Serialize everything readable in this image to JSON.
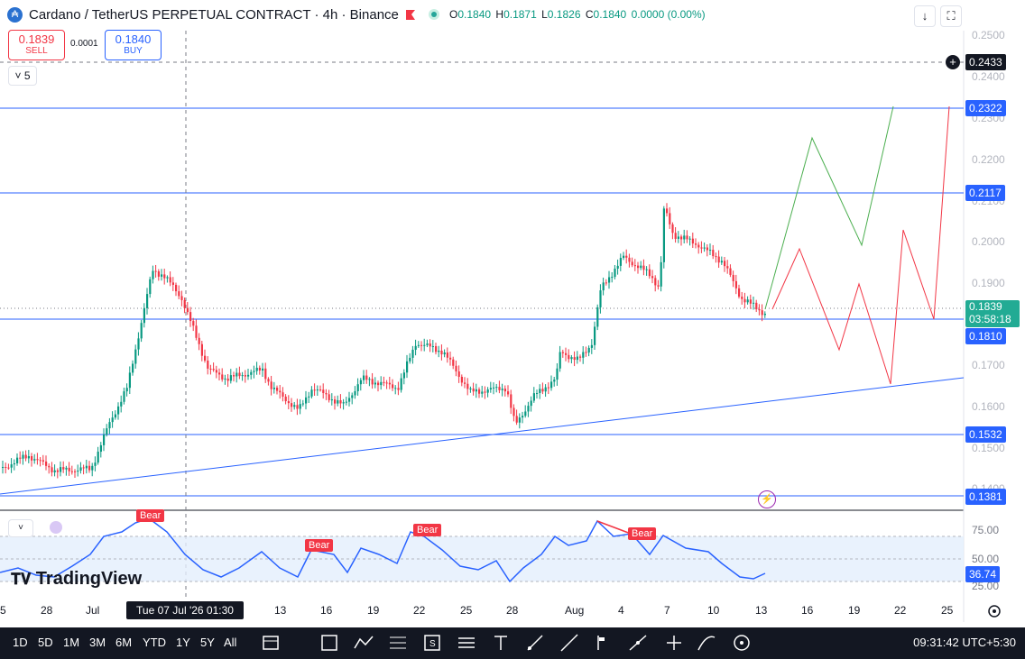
{
  "header": {
    "logo_glyph": "₳",
    "title": "Cardano / TetherUS PERPETUAL CONTRACT · 4h · Binance",
    "ohlc": {
      "o_label": "O",
      "o_value": "0.1840",
      "h_label": "H",
      "h_value": "0.1871",
      "l_label": "L",
      "l_value": "0.1826",
      "c_label": "C",
      "c_value": "0.1840",
      "change": "0.0000 (0.00%)"
    },
    "icons": [
      "flag-icon",
      "status-dot",
      "arrow-down-icon",
      "fullscreen-icon"
    ]
  },
  "trade": {
    "sell_price": "0.1839",
    "sell_label": "SELL",
    "spread": "0.0001",
    "buy_price": "0.1840",
    "buy_label": "BUY"
  },
  "collapse": {
    "label": "5"
  },
  "price_axis": {
    "ticks": [
      "0.2500",
      "0.2400",
      "0.2300",
      "0.2200",
      "0.2100",
      "0.2000",
      "0.1900",
      "0.1700",
      "0.1600",
      "0.1500",
      "0.1400"
    ],
    "labels": [
      {
        "text": "0.2433",
        "kind": "crosshair"
      },
      {
        "text": "0.2322",
        "kind": "level"
      },
      {
        "text": "0.2117",
        "kind": "level"
      },
      {
        "text": "0.1839",
        "kind": "price"
      },
      {
        "text": "03:58:18",
        "kind": "countdown"
      },
      {
        "text": "0.1810",
        "kind": "level"
      },
      {
        "text": "0.1532",
        "kind": "level"
      },
      {
        "text": "0.1381",
        "kind": "level"
      }
    ]
  },
  "rsi": {
    "axis": [
      "75.00",
      "50.00",
      "25.00"
    ],
    "value": "36.74",
    "bear_labels": [
      "Bear",
      "Bear",
      "Bear",
      "Bear"
    ]
  },
  "time_axis": {
    "labels": [
      "5",
      "28",
      "Jul",
      "13",
      "16",
      "19",
      "22",
      "25",
      "28",
      "Aug",
      "4",
      "7",
      "10",
      "13",
      "16",
      "19",
      "22",
      "25"
    ],
    "cursor": "Tue 07 Jul '26   01:30"
  },
  "branding": {
    "logo": "TradingView"
  },
  "bottom_bar": {
    "ranges": [
      "1D",
      "5D",
      "1M",
      "3M",
      "6M",
      "YTD",
      "1Y",
      "5Y",
      "All"
    ],
    "tools": [
      "calendar-range-icon",
      "rectangle-icon",
      "path-icon",
      "fib-icon",
      "long-short-icon",
      "lines-icon",
      "text-icon",
      "brush-icon",
      "trend-line-icon",
      "bar-pattern-icon",
      "projection-icon",
      "measure-icon",
      "shapes-icon",
      "anchor-icon"
    ],
    "clock": "09:31:42 UTC+5:30"
  },
  "colors": {
    "up": "#089981",
    "down": "#f23645",
    "level": "#2962ff",
    "bear": "#f23645",
    "rsi_line": "#2962ff",
    "rsi_band": "#e3effd",
    "projection_up": "#4caf50",
    "projection_down": "#f23645"
  }
}
